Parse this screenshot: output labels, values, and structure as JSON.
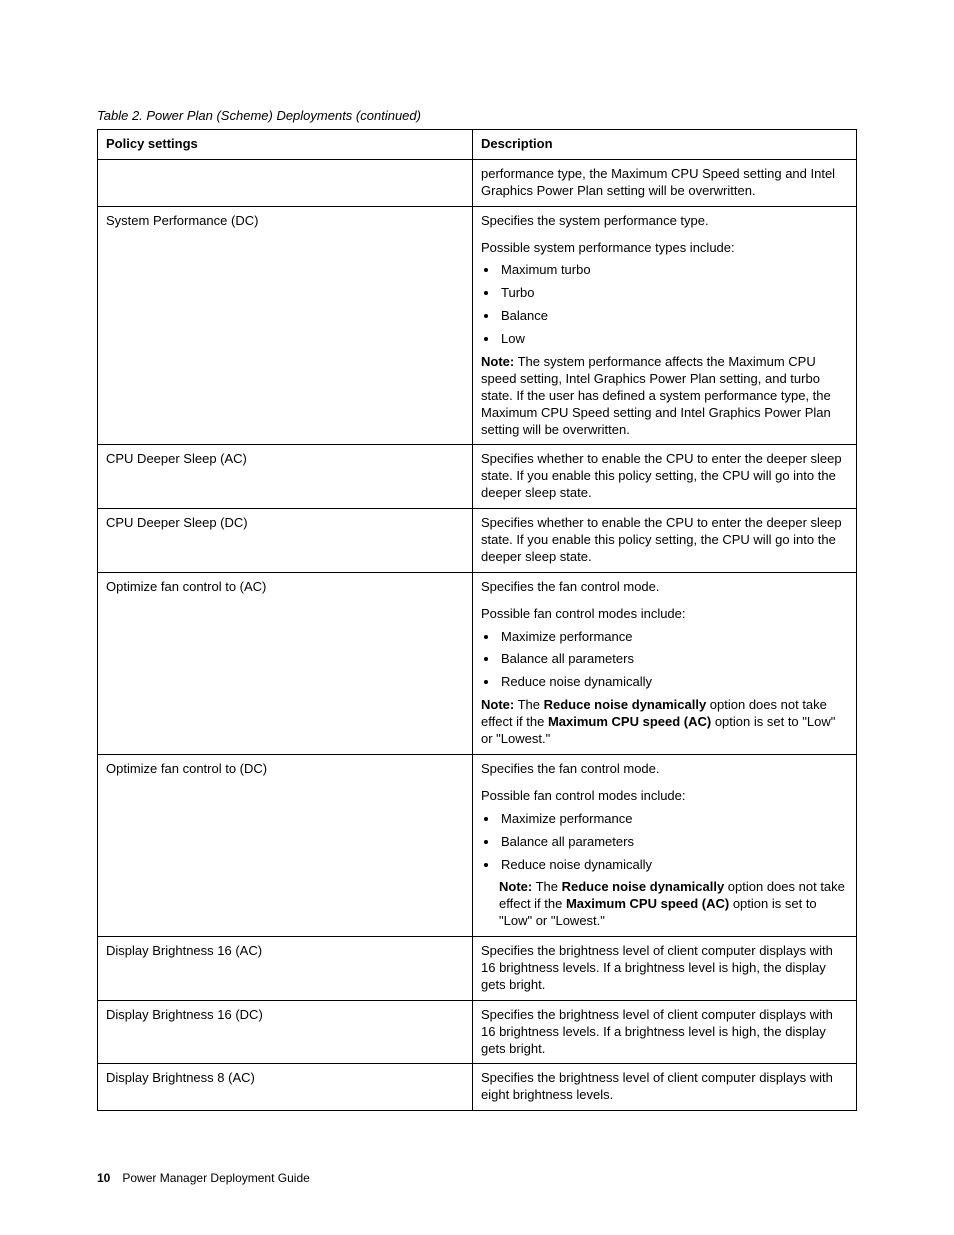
{
  "caption": "Table 2.  Power Plan (Scheme) Deployments (continued)",
  "headers": {
    "col1": "Policy settings",
    "col2": "Description"
  },
  "rows": {
    "r0": {
      "policy": "",
      "desc": "performance type, the Maximum CPU Speed setting and Intel Graphics Power Plan setting will be overwritten."
    },
    "r1": {
      "policy": "System Performance (DC)",
      "intro": "Specifies the system performance type.",
      "listIntro": "Possible system performance types include:",
      "items": [
        "Maximum turbo",
        "Turbo",
        "Balance",
        "Low"
      ],
      "noteLabel": "Note:",
      "noteText": " The system performance affects the Maximum CPU speed setting, Intel Graphics Power Plan setting, and turbo state.  If the user has defined a system performance type, the Maximum CPU Speed setting and Intel Graphics Power Plan setting will be overwritten."
    },
    "r2": {
      "policy": "CPU Deeper Sleep (AC)",
      "desc": "Specifies whether to enable the CPU to enter the deeper sleep state. If you enable this policy setting, the CPU will go into the deeper sleep state."
    },
    "r3": {
      "policy": "CPU Deeper Sleep (DC)",
      "desc": "Specifies whether to enable the CPU to enter the deeper sleep state. If you enable this policy setting, the CPU will go into the deeper sleep state."
    },
    "r4": {
      "policy": "Optimize fan control to (AC)",
      "intro": "Specifies the fan control mode.",
      "listIntro": "Possible fan control modes include:",
      "items": [
        "Maximize performance",
        "Balance all parameters",
        "Reduce noise dynamically"
      ],
      "noteLabel": "Note:",
      "noteA": " The ",
      "noteBold1": "Reduce noise dynamically",
      "noteB": " option does not take effect if the ",
      "noteBold2": "Maximum CPU speed (AC)",
      "noteC": " option is set to \"Low\" or \"Lowest.\""
    },
    "r5": {
      "policy": "Optimize fan control to (DC)",
      "intro": "Specifies the fan control mode.",
      "listIntro": "Possible fan control modes include:",
      "items": [
        "Maximize performance",
        "Balance all parameters",
        "Reduce noise dynamically"
      ],
      "noteLabel": "Note:",
      "noteA": " The ",
      "noteBold1": "Reduce noise dynamically",
      "noteB": " option does not take effect if the ",
      "noteBold2": "Maximum CPU speed (AC)",
      "noteC": " option is set to \"Low\" or \"Lowest.\""
    },
    "r6": {
      "policy": "Display Brightness 16 (AC)",
      "desc": "Specifies the brightness level of client computer displays with 16 brightness levels.  If a brightness level is high, the display gets bright."
    },
    "r7": {
      "policy": "Display Brightness 16 (DC)",
      "desc": "Specifies the brightness level of client computer displays with 16 brightness levels.  If a brightness level is high, the display gets bright."
    },
    "r8": {
      "policy": "Display Brightness 8 (AC)",
      "desc": "Specifies the brightness level of client computer displays with eight brightness levels."
    }
  },
  "footer": {
    "page": "10",
    "title": "Power Manager Deployment Guide"
  }
}
